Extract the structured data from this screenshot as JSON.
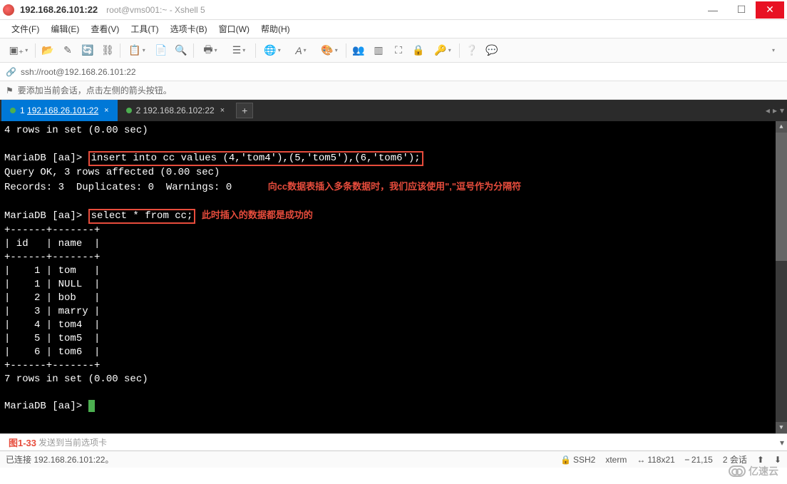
{
  "window": {
    "title_main": "192.168.26.101:22",
    "title_sub": "root@vms001:~ - Xshell 5"
  },
  "menu": {
    "file": "文件(F)",
    "edit": "编辑(E)",
    "view": "查看(V)",
    "tools": "工具(T)",
    "tab": "选项卡(B)",
    "window": "窗口(W)",
    "help": "帮助(H)"
  },
  "address": {
    "url": "ssh://root@192.168.26.101:22"
  },
  "infobar": {
    "hint": "要添加当前会话，点击左侧的箭头按钮。"
  },
  "tabs": [
    {
      "num": "1",
      "label": "192.168.26.101:22",
      "active": true
    },
    {
      "num": "2",
      "label": "192.168.26.102:22",
      "active": false
    }
  ],
  "terminal": {
    "line_rows_set": "4 rows in set (0.00 sec)",
    "prompt": "MariaDB [aa]>",
    "cmd_insert": "insert into cc values (4,'tom4'),(5,'tom5'),(6,'tom6');",
    "res_query_ok": "Query OK, 3 rows affected (0.00 sec)",
    "res_records": "Records: 3  Duplicates: 0  Warnings: 0",
    "anno_insert": "向cc数据表插入多条数据时，我们应该使用\",\"逗号作为分隔符",
    "cmd_select": "select * from cc;",
    "anno_select": "此时插入的数据都是成功的",
    "table_border_top": "+------+-------+",
    "table_header": "| id   | name  |",
    "table_rows": [
      "|    1 | tom   |",
      "|    1 | NULL  |",
      "|    2 | bob   |",
      "|    3 | marry |",
      "|    4 | tom4  |",
      "|    5 | tom5  |",
      "|    6 | tom6  |"
    ],
    "rows_in_set": "7 rows in set (0.00 sec)"
  },
  "chart_data": {
    "type": "table",
    "title": "cc",
    "columns": [
      "id",
      "name"
    ],
    "rows": [
      [
        1,
        "tom"
      ],
      [
        1,
        null
      ],
      [
        2,
        "bob"
      ],
      [
        3,
        "marry"
      ],
      [
        4,
        "tom4"
      ],
      [
        5,
        "tom5"
      ],
      [
        6,
        "tom6"
      ]
    ]
  },
  "figure_label": "图1-33",
  "inputbar": {
    "placeholder": "发送到当前选项卡"
  },
  "status": {
    "connected": "已连接 192.168.26.101:22。",
    "protocol": "SSH2",
    "term_type": "xterm",
    "size": "118x21",
    "cursor": "21,15",
    "sessions": "2 会话"
  },
  "watermark": "亿速云"
}
